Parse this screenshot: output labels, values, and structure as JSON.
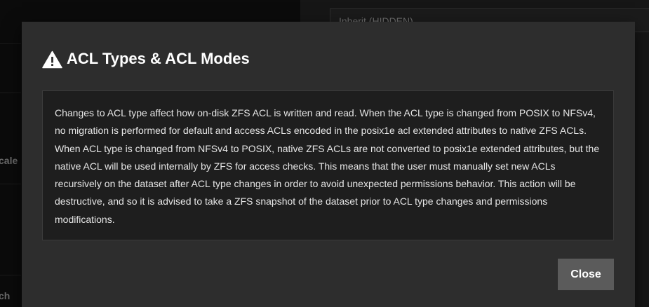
{
  "background": {
    "field_value": "Inherit (HIDDEN)",
    "side_label_1": "cale",
    "side_label_2": "ch"
  },
  "dialog": {
    "title": "ACL Types & ACL Modes",
    "title_icon": "warning-icon",
    "message": "Changes to ACL type affect how on-disk ZFS ACL is written and read. When the ACL type is changed from POSIX to NFSv4, no migration is performed for default and access ACLs encoded in the posix1e acl extended attributes to native ZFS ACLs. When ACL type is changed from NFSv4 to POSIX, native ZFS ACLs are not converted to posix1e extended attributes, but the native ACL will be used internally by ZFS for access checks. This means that the user must manually set new ACLs recursively on the dataset after ACL type changes in order to avoid unexpected permissions behavior. This action will be destructive, and so it is advised to take a ZFS snapshot of the dataset prior to ACL type changes and permissions modifications.",
    "close_label": "Close"
  },
  "colors": {
    "dialog_bg": "#2d2d2d",
    "body_bg": "#1e1e1e",
    "button_bg": "#5b5b5b",
    "text": "#e6e6e6"
  }
}
